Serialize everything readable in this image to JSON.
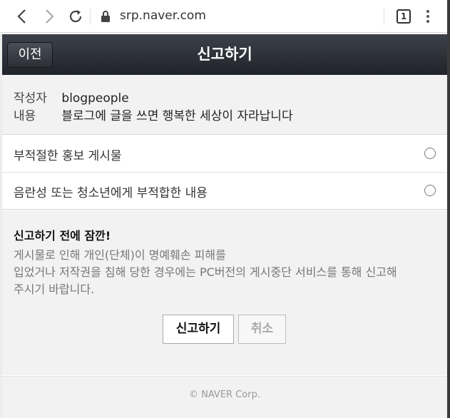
{
  "browser": {
    "url": "srp.naver.com",
    "tab_count": "1"
  },
  "header": {
    "back_label": "이전",
    "title": "신고하기"
  },
  "info": {
    "author_label": "작성자",
    "author_value": "blogpeople",
    "content_label": "내용",
    "content_value": "블로그에 글을 쓰면 행복한 세상이 자라납니다"
  },
  "options": [
    {
      "label": "부적절한 홍보 게시물",
      "selected": false
    },
    {
      "label": "음란성 또는 청소년에게 부적합한 내용",
      "selected": false
    }
  ],
  "notice": {
    "title": "신고하기 전에 잠깐!",
    "line1": "게시물로 인해 개인(단체)이 명예훼손 피해를",
    "line2": "입었거나 저작권을 침해 당한 경우에는 PC버전의 게시중단 서비스를 통해 신고해",
    "line3": "주시기 바랍니다."
  },
  "buttons": {
    "report": "신고하기",
    "cancel": "취소"
  },
  "footer": {
    "copyright": "© NAVER Corp."
  }
}
